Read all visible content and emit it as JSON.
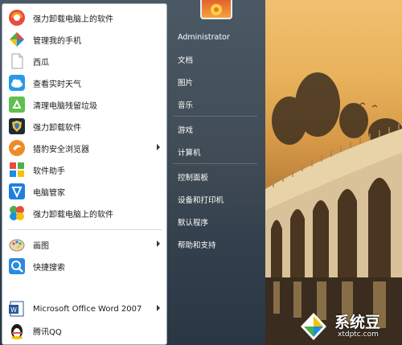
{
  "start_menu": {
    "programs": [
      {
        "label": "强力卸载电脑上的软件",
        "icon": "uninstall-globe-icon",
        "has_submenu": false
      },
      {
        "label": "管理我的手机",
        "icon": "phone-manager-icon",
        "has_submenu": false
      },
      {
        "label": "西瓜",
        "icon": "blank-document-icon",
        "has_submenu": false
      },
      {
        "label": "查看实时天气",
        "icon": "weather-cloud-icon",
        "has_submenu": false
      },
      {
        "label": "清理电脑残留垃圾",
        "icon": "recycle-icon",
        "has_submenu": false
      },
      {
        "label": "强力卸载软件",
        "icon": "uninstall-shield-icon",
        "has_submenu": false
      },
      {
        "label": "猎豹安全浏览器",
        "icon": "cheetah-browser-icon",
        "has_submenu": true
      },
      {
        "label": "软件助手",
        "icon": "software-helper-icon",
        "has_submenu": false
      },
      {
        "label": "电脑管家",
        "icon": "pc-manager-shield-icon",
        "has_submenu": false
      },
      {
        "label": "强力卸载电脑上的软件",
        "icon": "pinwheel-icon",
        "has_submenu": false
      },
      {
        "label": "画图",
        "icon": "paint-palette-icon",
        "has_submenu": true
      },
      {
        "label": "快捷搜索",
        "icon": "search-magnifier-icon",
        "has_submenu": false
      },
      {
        "label": "Microsoft Office Word 2007",
        "icon": "word-icon",
        "has_submenu": true
      },
      {
        "label": "腾讯QQ",
        "icon": "qq-penguin-icon",
        "has_submenu": false
      }
    ],
    "user_name": "Administrator",
    "system_links": [
      {
        "label": "Administrator"
      },
      {
        "label": "文档"
      },
      {
        "label": "图片"
      },
      {
        "label": "音乐"
      },
      {
        "label": "游戏"
      },
      {
        "label": "计算机"
      },
      {
        "label": "控制面板"
      },
      {
        "label": "设备和打印机"
      },
      {
        "label": "默认程序"
      },
      {
        "label": "帮助和支持"
      }
    ]
  },
  "watermark": {
    "title": "系统豆",
    "subtitle": "xtdptc.com"
  },
  "colors": {
    "menu_glass": "#2f4356",
    "program_panel": "#ffffff",
    "hover": "#dbe9f7",
    "link_text": "#ffffff"
  }
}
